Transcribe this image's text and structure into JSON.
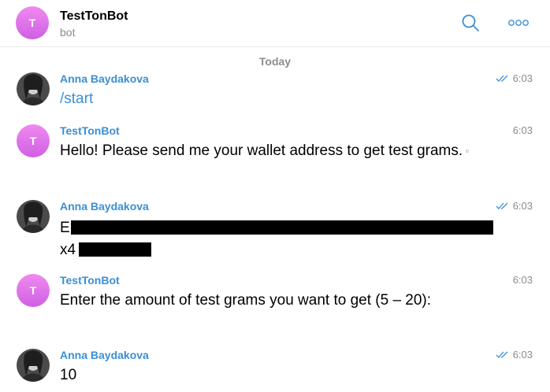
{
  "header": {
    "avatar_letter": "T",
    "title": "TestTonBot",
    "subtitle": "bot",
    "search_icon": "search-icon",
    "more_icon": "more-icon"
  },
  "date_label": "Today",
  "messages": [
    {
      "sender": "Anna Baydakova",
      "text": "/start",
      "time": "6:03",
      "read": true,
      "type": "user"
    },
    {
      "sender": "TestTonBot",
      "text": "Hello! Please send me your wallet address to get test grams.",
      "time": "6:03",
      "read": false,
      "type": "bot"
    },
    {
      "sender": "Anna Baydakova",
      "text_line1_prefix": "E",
      "text_line2_prefix": "x4",
      "time": "6:03",
      "read": true,
      "type": "user",
      "redacted": true
    },
    {
      "sender": "TestTonBot",
      "text": "Enter the amount of test grams you want to get (5 – 20):",
      "time": "6:03",
      "read": false,
      "type": "bot"
    },
    {
      "sender": "Anna Baydakova",
      "text": "10",
      "time": "6:03",
      "read": true,
      "type": "user"
    }
  ],
  "colors": {
    "accent": "#3a8fd4",
    "bot_avatar": "#d96ae6",
    "muted": "#8c8c8c"
  }
}
